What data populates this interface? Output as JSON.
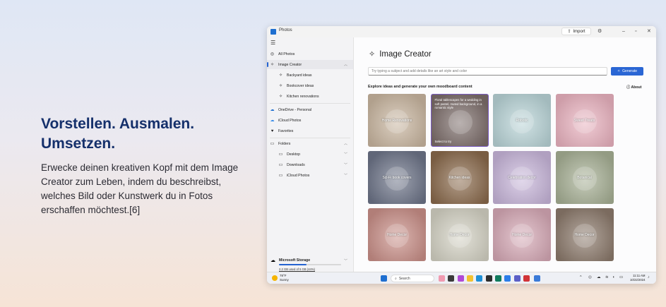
{
  "hero": {
    "title": "Vorstellen. Ausmalen. Umsetzen.",
    "body": "Erwecke deinen kreativen Kopf mit dem Image Creator zum Leben, indem du beschreibst, welches Bild oder Kunstwerk du in Fotos erschaffen möchtest.[6]"
  },
  "window": {
    "title": "Photos",
    "import_label": "Import"
  },
  "sidebar": {
    "items": [
      {
        "label": "All Photos",
        "icon": "photos-icon"
      },
      {
        "label": "Image Creator",
        "icon": "image-creator-icon"
      },
      {
        "label": "Backyard ideas",
        "icon": "image-creator-icon"
      },
      {
        "label": "Bookcover ideas",
        "icon": "image-creator-icon"
      },
      {
        "label": "Kitchen renovations",
        "icon": "image-creator-icon"
      },
      {
        "label": "OneDrive - Personal",
        "icon": "onedrive-icon"
      },
      {
        "label": "iCloud Photos",
        "icon": "icloud-icon"
      },
      {
        "label": "Favorites",
        "icon": "heart-icon"
      },
      {
        "label": "Folders",
        "icon": "folder-icon"
      },
      {
        "label": "Desktop",
        "icon": "folder-icon"
      },
      {
        "label": "Downloads",
        "icon": "folder-icon"
      },
      {
        "label": "iCloud Photos",
        "icon": "folder-icon"
      }
    ],
    "storage": {
      "title": "Microsoft Storage",
      "usage": "2.2 GB used of 5 GB (44%)",
      "fraction": 0.44
    }
  },
  "main": {
    "title": "Image Creator",
    "prompt_placeholder": "Try typing a subject and add details like an art style and color",
    "generate_label": "Generate",
    "explore_label": "Explore ideas and generate your own moodboard content",
    "about_label": "About",
    "tiles": [
      {
        "label": "Home Renovations",
        "bg": "#c9b6a0"
      },
      {
        "label": "",
        "bg": "#7c6d6a",
        "desc": "Floral tablescapes for a wedding in soft pastel, muted background, in a romantic style",
        "select": "Select to try"
      },
      {
        "label": "Robotic",
        "bg": "#b9d4d7"
      },
      {
        "label": "Sweet Treats",
        "bg": "#eab3c0"
      },
      {
        "label": "Sci-Fi book covers",
        "bg": "#6d7488"
      },
      {
        "label": "Kitchen ideas",
        "bg": "#8a6a4c"
      },
      {
        "label": "Celebration decor",
        "bg": "#c8b6da"
      },
      {
        "label": "Botanical",
        "bg": "#a7b095"
      },
      {
        "label": "Home Decor",
        "bg": "#c98f88"
      },
      {
        "label": "Home Decor",
        "bg": "#d4d2c4"
      },
      {
        "label": "Home Decor",
        "bg": "#d6a9b6"
      },
      {
        "label": "Home Decor",
        "bg": "#8c7a6c"
      }
    ]
  },
  "taskbar": {
    "temp": "78°F",
    "condition": "Sunny",
    "search_label": "Search",
    "time": "11:11 AM",
    "date": "10/22/2024"
  }
}
